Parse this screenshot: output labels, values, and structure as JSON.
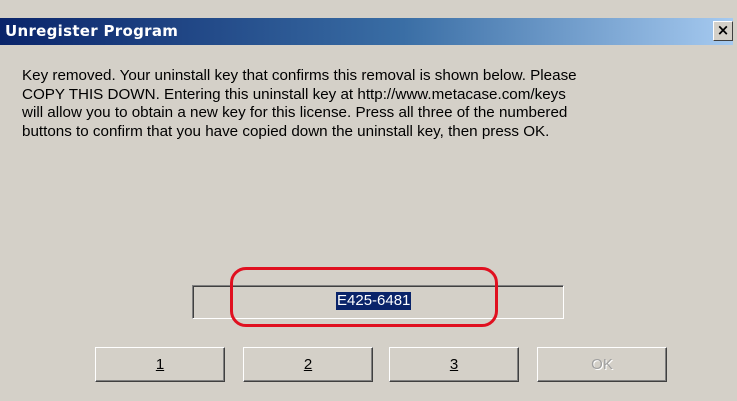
{
  "dialog": {
    "title": "Unregister Program",
    "close_glyph": "×",
    "message": "Key removed. Your uninstall key that confirms this removal is shown below. Please\nCOPY THIS DOWN. Entering this uninstall key at http://www.metacase.com/keys\nwill allow you to obtain a new key for this license. Press all three of the numbered\nbuttons to confirm that you have copied down the uninstall key, then press OK.",
    "uninstall_key": "E425-6481",
    "buttons": [
      {
        "label": "1",
        "enabled": true
      },
      {
        "label": "2",
        "enabled": true
      },
      {
        "label": "3",
        "enabled": true
      },
      {
        "label": "OK",
        "enabled": false
      }
    ],
    "highlight_color": "#e01020",
    "title_bar_color": "#0a246a"
  }
}
